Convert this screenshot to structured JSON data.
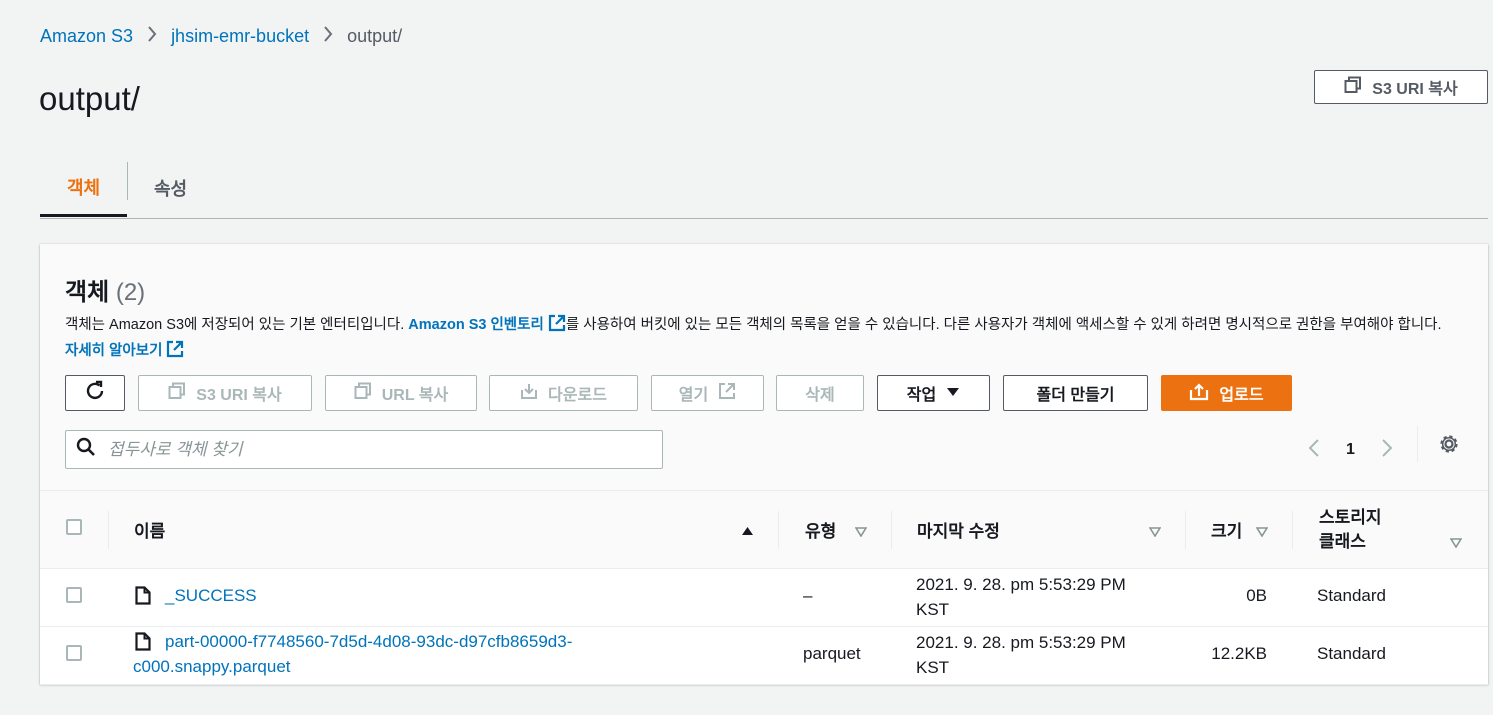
{
  "breadcrumb": {
    "items": [
      "Amazon S3",
      "jhsim-emr-bucket"
    ],
    "current": "output/"
  },
  "page": {
    "title": "output/",
    "copy_uri_label": "S3 URI 복사"
  },
  "tabs": [
    {
      "label": "객체",
      "active": true
    },
    {
      "label": "속성",
      "active": false
    }
  ],
  "objects_panel": {
    "title": "객체",
    "count": "(2)",
    "desc_part1": "객체는 Amazon S3에 저장되어 있는 기본 엔터티입니다. ",
    "desc_link1": "Amazon S3 인벤토리",
    "desc_part2": "를 사용하여 버킷에 있는 모든 객체의 목록을 얻을 수 있습니다. 다른 사용자가 객체에 액세스할 수 있게 하려면 명시적으로 권한을 부여해야 합니다. ",
    "desc_link2": "자세히 알아보기"
  },
  "toolbar": {
    "copy_s3_uri": "S3 URI 복사",
    "copy_url": "URL 복사",
    "download": "다운로드",
    "open": "열기",
    "delete": "삭제",
    "actions": "작업",
    "create_folder": "폴더 만들기",
    "upload": "업로드"
  },
  "search": {
    "placeholder": "접두사로 객체 찾기"
  },
  "pagination": {
    "page": "1"
  },
  "table": {
    "headers": {
      "name": "이름",
      "type": "유형",
      "modified": "마지막 수정",
      "size": "크기",
      "storage_line1": "스토리지",
      "storage_line2": "클래스"
    },
    "rows": [
      {
        "name": "_SUCCESS",
        "name_line2": "",
        "type": "–",
        "modified_line1": "2021. 9. 28. pm 5:53:29 PM",
        "modified_line2": "KST",
        "size": "0B",
        "storage": "Standard"
      },
      {
        "name": "part-00000-f7748560-7d5d-4d08-93dc-d97cfb8659d3-",
        "name_line2": "c000.snappy.parquet",
        "type": "parquet",
        "modified_line1": "2021. 9. 28. pm 5:53:29 PM",
        "modified_line2": "KST",
        "size": "12.2KB",
        "storage": "Standard"
      }
    ]
  },
  "colors": {
    "accent": "#ec7211",
    "link": "#0073bb",
    "text": "#16191f",
    "disabled": "#aab7b8",
    "background": "#f2f3f3"
  }
}
